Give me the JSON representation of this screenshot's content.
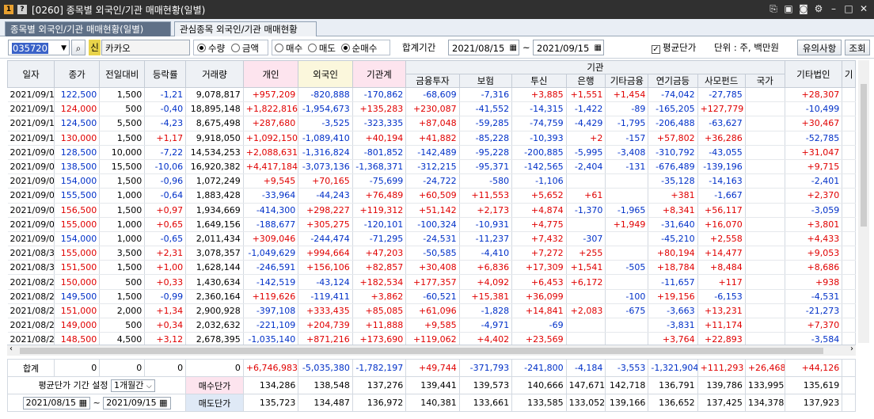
{
  "window": {
    "title": "[0260] 종목별 외국인/기관 매매현황(일별)"
  },
  "tabs": [
    "종목별 외국인/기관 매매현황(일별)",
    "관심종목 외국인/기관 매매현황"
  ],
  "toolbar": {
    "code": "035720",
    "badge": "신",
    "name": "카카오",
    "radio_group1": [
      "수량",
      "금액"
    ],
    "radio_group1_selected": "수량",
    "radio_group2": [
      "매수",
      "매도",
      "순매수"
    ],
    "radio_group2_selected": "순매수",
    "period_label": "합계기간",
    "date_from": "2021/08/15",
    "date_to": "2021/09/15",
    "tilde": "~",
    "avg_price_label": "평균단가",
    "avg_price_checked": true,
    "unit_label": "단위 : 주, 백만원",
    "notice_button": "유의사항",
    "query_button": "조회"
  },
  "headers": {
    "date": "일자",
    "close": "종가",
    "change": "전일대비",
    "rate": "등락률",
    "volume": "거래량",
    "individual": "개인",
    "foreign": "외국인",
    "inst_total": "기관계",
    "inst_group": "기관",
    "sub": [
      "금융투자",
      "보험",
      "투신",
      "은행",
      "기타금융",
      "연기금등",
      "사모펀드",
      "국가"
    ],
    "other_corp": "기타법인",
    "last": "기"
  },
  "rows": [
    [
      "2021/09/15",
      "122,500",
      "1,500",
      "-1,21",
      "9,078,817",
      "+957,209",
      "-820,888",
      "-170,862",
      "-68,609",
      "-7,316",
      "+3,885",
      "+1,551",
      "+1,454",
      "-74,042",
      "-27,785",
      "",
      "+28,307"
    ],
    [
      "2021/09/14",
      "124,000",
      "500",
      "-0,40",
      "18,895,148",
      "+1,822,816",
      "-1,954,673",
      "+135,283",
      "+230,087",
      "-41,552",
      "-14,315",
      "-1,422",
      "-89",
      "-165,205",
      "+127,779",
      "",
      "-10,499"
    ],
    [
      "2021/09/13",
      "124,500",
      "5,500",
      "-4,23",
      "8,675,498",
      "+287,680",
      "-3,525",
      "-323,335",
      "+87,048",
      "-59,285",
      "-74,759",
      "-4,429",
      "-1,795",
      "-206,488",
      "-63,627",
      "",
      "+30,467"
    ],
    [
      "2021/09/10",
      "130,000",
      "1,500",
      "+1,17",
      "9,918,050",
      "+1,092,150",
      "-1,089,410",
      "+40,194",
      "+41,882",
      "-85,228",
      "-10,393",
      "+2",
      "-157",
      "+57,802",
      "+36,286",
      "",
      "-52,785"
    ],
    [
      "2021/09/09",
      "128,500",
      "10,000",
      "-7,22",
      "14,534,253",
      "+2,088,631",
      "-1,316,824",
      "-801,852",
      "-142,489",
      "-95,228",
      "-200,885",
      "-5,995",
      "-3,408",
      "-310,792",
      "-43,055",
      "",
      "+31,047"
    ],
    [
      "2021/09/08",
      "138,500",
      "15,500",
      "-10,06",
      "16,920,382",
      "+4,417,184",
      "-3,073,136",
      "-1,368,371",
      "-312,215",
      "-95,371",
      "-142,565",
      "-2,404",
      "-131",
      "-676,489",
      "-139,196",
      "",
      "+9,715"
    ],
    [
      "2021/09/07",
      "154,000",
      "1,500",
      "-0,96",
      "1,072,249",
      "+9,545",
      "+70,165",
      "-75,699",
      "-24,722",
      "-580",
      "-1,106",
      "",
      "",
      "-35,128",
      "-14,163",
      "",
      "-2,401"
    ],
    [
      "2021/09/06",
      "155,500",
      "1,000",
      "-0,64",
      "1,883,428",
      "-33,964",
      "-44,243",
      "+76,489",
      "+60,509",
      "+11,553",
      "+5,652",
      "+61",
      "",
      "+381",
      "-1,667",
      "",
      "+2,370"
    ],
    [
      "2021/09/03",
      "156,500",
      "1,500",
      "+0,97",
      "1,934,669",
      "-414,300",
      "+298,227",
      "+119,312",
      "+51,142",
      "+2,173",
      "+4,874",
      "-1,370",
      "-1,965",
      "+8,341",
      "+56,117",
      "",
      "-3,059"
    ],
    [
      "2021/09/02",
      "155,000",
      "1,000",
      "+0,65",
      "1,649,156",
      "-188,677",
      "+305,275",
      "-120,101",
      "-100,324",
      "-10,931",
      "+4,775",
      "",
      "+1,949",
      "-31,640",
      "+16,070",
      "",
      "+3,801"
    ],
    [
      "2021/09/01",
      "154,000",
      "1,000",
      "-0,65",
      "2,011,434",
      "+309,046",
      "-244,474",
      "-71,295",
      "-24,531",
      "-11,237",
      "+7,432",
      "-307",
      "",
      "-45,210",
      "+2,558",
      "",
      "+4,433"
    ],
    [
      "2021/08/31",
      "155,000",
      "3,500",
      "+2,31",
      "3,078,357",
      "-1,049,629",
      "+994,664",
      "+47,203",
      "-50,585",
      "-4,410",
      "+7,272",
      "+255",
      "",
      "+80,194",
      "+14,477",
      "",
      "+9,053"
    ],
    [
      "2021/08/30",
      "151,500",
      "1,500",
      "+1,00",
      "1,628,144",
      "-246,591",
      "+156,106",
      "+82,857",
      "+30,408",
      "+6,836",
      "+17,309",
      "+1,541",
      "-505",
      "+18,784",
      "+8,484",
      "",
      "+8,686"
    ],
    [
      "2021/08/27",
      "150,000",
      "500",
      "+0,33",
      "1,430,634",
      "-142,519",
      "-43,124",
      "+182,534",
      "+177,357",
      "+4,092",
      "+6,453",
      "+6,172",
      "",
      "-11,657",
      "+117",
      "",
      "+938"
    ],
    [
      "2021/08/26",
      "149,500",
      "1,500",
      "-0,99",
      "2,360,164",
      "+119,626",
      "-119,411",
      "+3,862",
      "-60,521",
      "+15,381",
      "+36,099",
      "",
      "-100",
      "+19,156",
      "-6,153",
      "",
      "-4,531"
    ],
    [
      "2021/08/25",
      "151,000",
      "2,000",
      "+1,34",
      "2,900,928",
      "-397,108",
      "+333,435",
      "+85,085",
      "+61,096",
      "-1,828",
      "+14,841",
      "+2,083",
      "-675",
      "-3,663",
      "+13,231",
      "",
      "-21,273"
    ],
    [
      "2021/08/24",
      "149,000",
      "500",
      "+0,34",
      "2,032,632",
      "-221,109",
      "+204,739",
      "+11,888",
      "+9,585",
      "-4,971",
      "-69",
      "",
      "",
      "-3,831",
      "+11,174",
      "",
      "+7,370"
    ],
    [
      "2021/08/23",
      "148,500",
      "4,500",
      "+3,12",
      "2,678,395",
      "-1,035,140",
      "+871,216",
      "+173,690",
      "+119,062",
      "+4,402",
      "+23,569",
      "",
      "",
      "+3,764",
      "+22,893",
      "",
      "-3,584"
    ]
  ],
  "row_colors": {
    "close": [
      "dn",
      "up",
      "dn",
      "up",
      "dn",
      "dn",
      "dn",
      "dn",
      "up",
      "up",
      "dn",
      "up",
      "up",
      "up",
      "dn",
      "up",
      "up",
      "up"
    ]
  },
  "summary": {
    "label": "합계",
    "values": [
      "0",
      "0",
      "0",
      "0",
      "+6,746,983",
      "-5,035,380",
      "-1,782,197",
      "+49,744",
      "-371,793",
      "-241,800",
      "-4,184",
      "-3,553",
      "-1,321,904",
      "+111,293",
      "+26,468",
      "+44,126"
    ]
  },
  "avg_settings": {
    "label": "평균단가 기간 설정",
    "period": "1개월간",
    "date_from": "2021/08/15",
    "date_to": "2021/09/15",
    "tilde": "~",
    "buy_label": "매수단가",
    "sell_label": "매도단가",
    "buy_values": [
      "134,286",
      "138,548",
      "137,276",
      "139,441",
      "139,573",
      "140,666",
      "147,671",
      "142,718",
      "136,791",
      "139,786",
      "133,995",
      "135,619"
    ],
    "sell_values": [
      "135,723",
      "134,487",
      "136,972",
      "140,381",
      "133,661",
      "133,585",
      "133,052",
      "139,166",
      "136,652",
      "137,425",
      "134,378",
      "137,923"
    ]
  },
  "colors": {
    "titlebar": "#303030",
    "active_tab": "#5f7087",
    "up": "#e00000",
    "down": "#0030c8",
    "pink_header": "#fde4ee",
    "yellow_header": "#fbf7dc"
  }
}
